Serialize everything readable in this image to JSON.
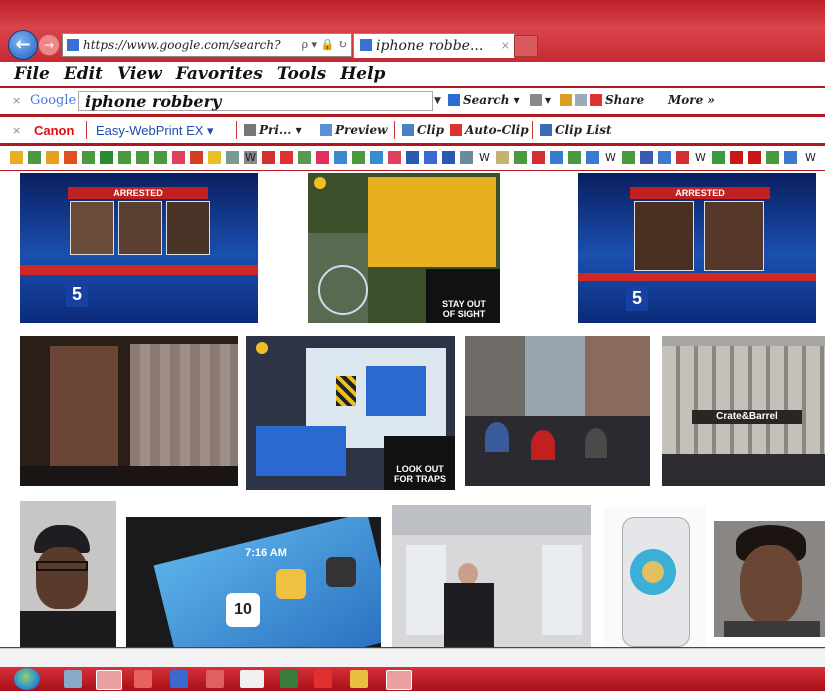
{
  "browser": {
    "address_url": "https://www.google.com/search?",
    "address_icons": "ρ ▾ 🔒 ↻",
    "tab_title": "iphone robbe...",
    "tab_close": "×",
    "back_glyph": "←",
    "forward_glyph": "→"
  },
  "menu": [
    "File",
    "Edit",
    "View",
    "Favorites",
    "Tools",
    "Help"
  ],
  "google_toolbar": {
    "close": "×",
    "logo": "Google",
    "query": "iphone robbery",
    "search_label": "Search ▾",
    "page_label": "▾",
    "share_label": "Share",
    "more_label": "More »"
  },
  "print_toolbar": {
    "close": "×",
    "canon": "Canon",
    "easy_webprint": "Easy-WebPrint EX ▾",
    "print_label": "Pri...",
    "preview_label": "Preview",
    "clip_label": "Clip",
    "auto_clip_label": "Auto-Clip",
    "clip_list_label": "Clip List"
  },
  "results": [
    {
      "kind": "news-arrested",
      "banner": "ARRESTED",
      "channel": "5"
    },
    {
      "kind": "game-stay-out",
      "caption_line1": "STAY OUT",
      "caption_line2": "OF SIGHT"
    },
    {
      "kind": "news-arrested",
      "banner": "ARRESTED",
      "channel": "5"
    },
    {
      "kind": "surveillance-door"
    },
    {
      "kind": "game-traps",
      "caption_line1": "LOOK OUT",
      "caption_line2": "FOR TRAPS"
    },
    {
      "kind": "crowd-street"
    },
    {
      "kind": "storefront",
      "sign": "Crate&Barrel"
    },
    {
      "kind": "selfie-cap"
    },
    {
      "kind": "iphone-screen",
      "clock": "7:16 AM",
      "date": "10"
    },
    {
      "kind": "cctv-bus"
    },
    {
      "kind": "phone-case"
    },
    {
      "kind": "mugshot"
    }
  ],
  "colors": {
    "chrome_red": "#c0202a",
    "link_blue": "#1b4fa8",
    "canon_red": "#d11111"
  }
}
